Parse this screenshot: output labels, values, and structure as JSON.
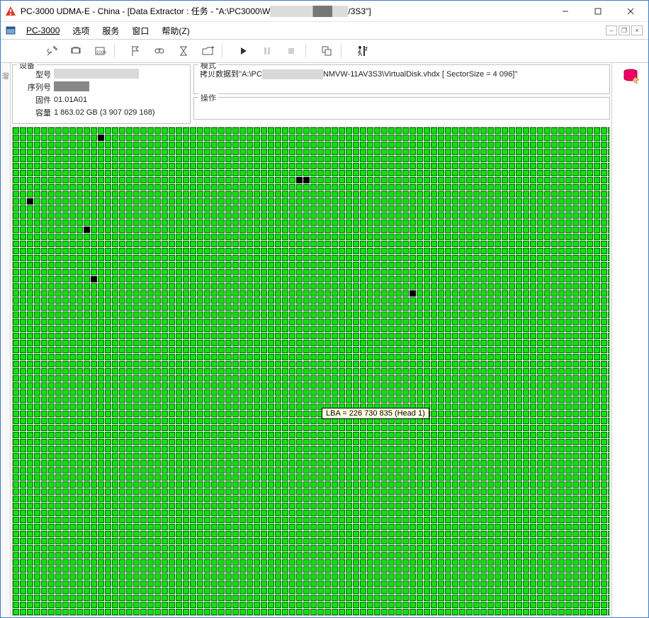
{
  "window": {
    "title_prefix": "PC-3000 UDMA-E - China - [Data Extractor : 任务 - \"A:\\PC3000\\W",
    "title_suffix": "/3S3\"]"
  },
  "menu": {
    "app": "PC-3000",
    "options": "选项",
    "service": "服务",
    "window": "窗口",
    "help": "帮助(Z)"
  },
  "device": {
    "group_label": "设备",
    "model_label": "型号",
    "model_value": "",
    "serial_label": "序列号",
    "serial_value": "",
    "firmware_label": "固件",
    "firmware_value": "01.01A01",
    "capacity_label": "容量",
    "capacity_value": "1 863.02 GB (3 907 029 168)"
  },
  "mode": {
    "group_label": "模式",
    "text_prefix": "拷贝数据到''A:\\PC",
    "text_suffix": "NMVW-11AV3S3\\VirtualDisk.vhdx [ SectorSize = 4 096]''"
  },
  "operation": {
    "group_label": "操作"
  },
  "tooltip": {
    "text": "LBA =   226 730 835 (Head 1)"
  },
  "sidecollapsed": "溜",
  "sector_map": {
    "cols": 86,
    "rows": 72,
    "cellw": 9,
    "cellh": 9,
    "gap": 1,
    "color_ok": "#0ee20e",
    "color_border": "#006400",
    "color_bad": "#000000",
    "bad_cells": [
      {
        "r": 1,
        "c": 12
      },
      {
        "r": 7,
        "c": 40
      },
      {
        "r": 7,
        "c": 41
      },
      {
        "r": 10,
        "c": 2
      },
      {
        "r": 14,
        "c": 10
      },
      {
        "r": 21,
        "c": 11
      },
      {
        "r": 23,
        "c": 56
      }
    ]
  }
}
